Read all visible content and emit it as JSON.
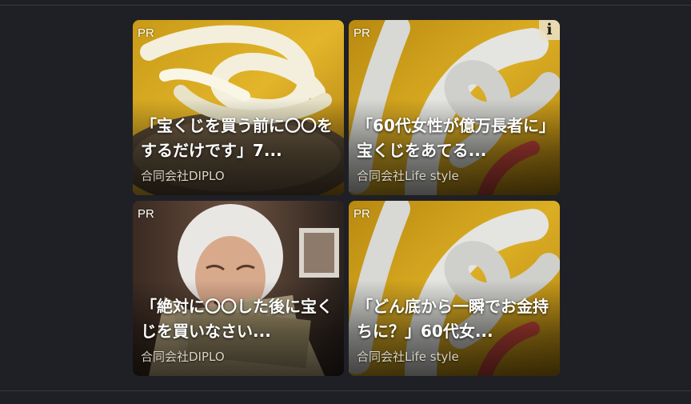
{
  "ads": [
    {
      "pr": "PR",
      "title": "「宝くじを買う前に〇〇をするだけです」7...",
      "advertiser": "合同会社DIPLO",
      "image": "white-snake-on-gold"
    },
    {
      "pr": "PR",
      "title": "「60代女性が億万長者に」宝くじをあてる...",
      "advertiser": "合同会社Life style",
      "image": "white-snake-coiled",
      "info_icon": "i"
    },
    {
      "pr": "PR",
      "title": "「絶対に〇〇した後に宝くじを買いなさい...",
      "advertiser": "合同会社DIPLO",
      "image": "elderly-woman-with-money"
    },
    {
      "pr": "PR",
      "title": "「どん底から一瞬でお金持ちに？」60代女...",
      "advertiser": "合同会社Life style",
      "image": "white-snake-coiled"
    }
  ]
}
